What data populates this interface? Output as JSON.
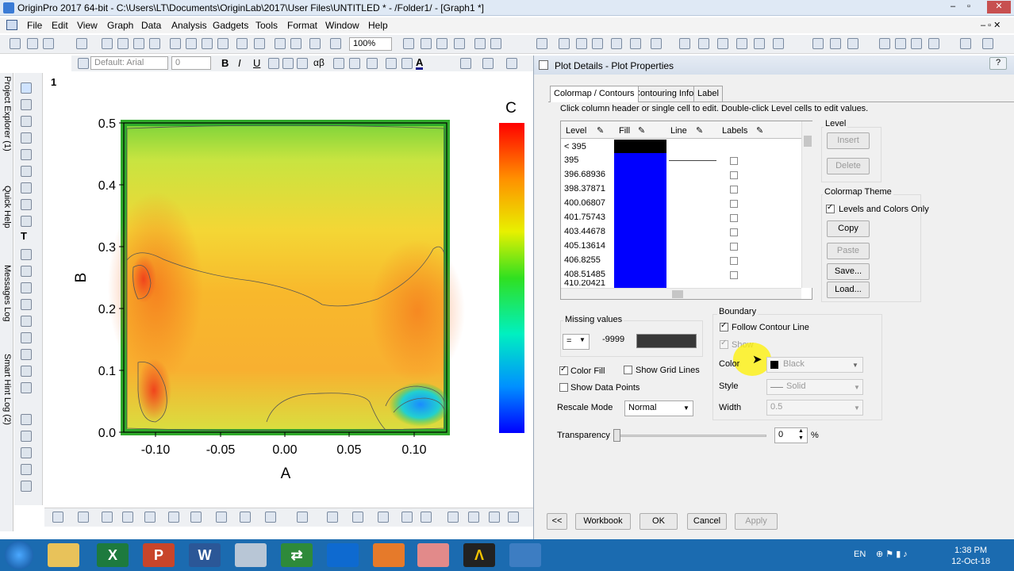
{
  "window": {
    "title": "OriginPro 2017 64-bit - C:\\Users\\LT\\Documents\\OriginLab\\2017\\User Files\\UNTITLED * - /Folder1/ - [Graph1 *]"
  },
  "menu": [
    "File",
    "Edit",
    "View",
    "Graph",
    "Data",
    "Analysis",
    "Gadgets",
    "Tools",
    "Format",
    "Window",
    "Help"
  ],
  "toolbar": {
    "zoom": "100%",
    "font": "Default: Arial",
    "font_size": "0",
    "bold": "B",
    "italic": "I",
    "underline": "U",
    "greek": "αβ"
  },
  "side_tabs": [
    "Project Explorer (1)",
    "Quick Help",
    "Messages Log",
    "Smart Hint Log (2)"
  ],
  "graph": {
    "layer": "1",
    "colorbar_title": "C",
    "chart_data": {
      "type": "heatmap",
      "title": "",
      "xlabel": "A",
      "ylabel": "B",
      "xlim": [
        -0.13,
        0.125
      ],
      "ylim": [
        0.0,
        0.5
      ],
      "x_ticks": [
        "-0.10",
        "-0.05",
        "0.00",
        "0.05",
        "0.10"
      ],
      "y_ticks": [
        "0.0",
        "0.1",
        "0.2",
        "0.3",
        "0.4",
        "0.5"
      ],
      "colorbar": "rainbow (blue low, red high)"
    }
  },
  "dialog": {
    "title": "Plot Details - Plot Properties",
    "tabs": [
      "Colormap / Contours",
      "Contouring Info",
      "Label"
    ],
    "hint": "Click column header or single cell to edit. Double-click Level cells to edit values.",
    "grid_headers": [
      "Level",
      "Fill",
      "Line",
      "Labels"
    ],
    "levels": [
      "< 395",
      "395",
      "396.68936",
      "398.37871",
      "400.06807",
      "401.75743",
      "403.44678",
      "405.13614",
      "406.8255",
      "408.51485",
      "410.20421"
    ],
    "level_group": {
      "title": "Level",
      "insert": "Insert",
      "delete": "Delete"
    },
    "theme_group": {
      "title": "Colormap Theme",
      "levels_colors": "Levels and Colors Only",
      "copy": "Copy",
      "paste": "Paste",
      "save": "Save...",
      "load": "Load..."
    },
    "missing": {
      "title": "Missing values",
      "op": "=",
      "value": "-9999"
    },
    "color_fill": "Color Fill",
    "show_grid_lines": "Show Grid Lines",
    "show_data_points": "Show Data Points",
    "rescale_label": "Rescale Mode",
    "rescale_value": "Normal",
    "boundary": {
      "title": "Boundary",
      "follow": "Follow Contour Line",
      "show": "Show",
      "color_label": "Color",
      "color_value": "Black",
      "style_label": "Style",
      "style_value": "Solid",
      "width_label": "Width",
      "width_value": "0.5"
    },
    "transparency_label": "Transparency",
    "transparency_value": "0",
    "transparency_unit": "%",
    "buttons": {
      "collapse": "<<",
      "workbook": "Workbook",
      "ok": "OK",
      "cancel": "Cancel",
      "apply": "Apply"
    }
  },
  "taskbar": {
    "lang": "EN",
    "time": "1:38 PM",
    "date": "12-Oct-18"
  },
  "colors": {
    "titlebar": "#dfe9f5",
    "taskbar": "#1b6bb0",
    "fill_black": "#000000",
    "fill_blue": "#0000ff"
  }
}
